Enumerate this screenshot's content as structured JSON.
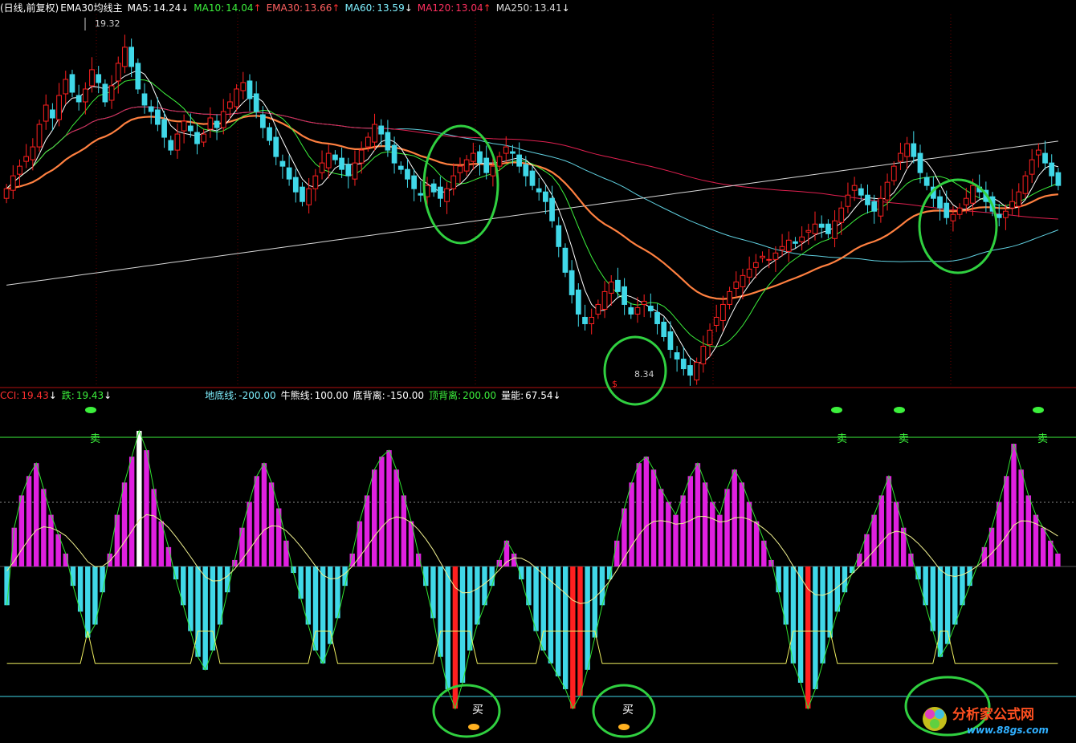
{
  "main_header": {
    "title": "(日线,前复权)",
    "indicator": "EMA30均线主",
    "items": [
      {
        "label": "MA5:",
        "value": "14.24",
        "color": "#ffffff",
        "trend": "down"
      },
      {
        "label": "MA10:",
        "value": "14.04",
        "color": "#3cf03c",
        "trend": "up"
      },
      {
        "label": "EMA30:",
        "value": "13.66",
        "color": "#ff6060",
        "trend": "up"
      },
      {
        "label": "MA60:",
        "value": "13.59",
        "color": "#7ff0ff",
        "trend": "down"
      },
      {
        "label": "MA120:",
        "value": "13.04",
        "color": "#ff3060",
        "trend": "up"
      },
      {
        "label": "MA250:",
        "value": "13.41",
        "color": "#d8d8d8",
        "trend": "down"
      }
    ]
  },
  "sub_header": {
    "items": [
      {
        "label": "CCI:",
        "value": "19.43",
        "color": "#ff3030",
        "trend": "down"
      },
      {
        "label": "跌:",
        "value": "19.43",
        "color": "#3cf03c",
        "trend": "down"
      },
      {
        "label": "地底线:",
        "value": "-200.00",
        "color": "#7ff0ff",
        "trend": ""
      },
      {
        "label": "牛熊线:",
        "value": "100.00",
        "color": "#ffffff",
        "trend": ""
      },
      {
        "label": "底背离:",
        "value": "-150.00",
        "color": "#ffffff",
        "trend": ""
      },
      {
        "label": "顶背离:",
        "value": "200.00",
        "color": "#3cf03c",
        "trend": ""
      },
      {
        "label": "量能:",
        "value": "67.54",
        "color": "#ffffff",
        "trend": "down"
      }
    ]
  },
  "annotations": {
    "high_price": "19.32",
    "low_price": "8.34",
    "sell_label": "卖",
    "buy_label": "买"
  },
  "watermark": {
    "name": "分析家公式网",
    "url": "www.88gs.com"
  },
  "colors": {
    "rise": "#ff2020",
    "fall": "#40d8e8",
    "ma5": "#ffffff",
    "ma10": "#3cf03c",
    "ema30": "#ff8040",
    "ma60": "#60d0e0",
    "ma120": "#e02050",
    "ma250": "#d8d8d8",
    "cci_pos": "#e020e0",
    "cci_neg": "#40d8e8",
    "circle": "#30d040"
  },
  "chart_data": [
    {
      "type": "candlestick",
      "y_range": [
        8.34,
        19.32
      ],
      "ma_series": [
        "MA5",
        "MA10",
        "EMA30",
        "MA60",
        "MA120",
        "MA250"
      ],
      "close": [
        14.2,
        14.6,
        14.9,
        15.2,
        15.5,
        16.2,
        16.8,
        16.4,
        17.1,
        17.6,
        17.2,
        16.9,
        17.3,
        17.9,
        17.5,
        16.9,
        17.4,
        18.1,
        18.6,
        18.0,
        17.3,
        16.8,
        16.6,
        16.2,
        15.8,
        15.4,
        15.9,
        16.3,
        16.0,
        15.6,
        15.9,
        16.4,
        16.1,
        16.6,
        16.9,
        17.3,
        17.5,
        17.0,
        16.6,
        16.1,
        15.7,
        15.2,
        14.9,
        14.5,
        14.1,
        13.8,
        14.2,
        14.6,
        15.0,
        15.3,
        15.1,
        14.8,
        14.6,
        15.0,
        15.4,
        15.8,
        16.2,
        15.9,
        15.4,
        15.0,
        14.8,
        14.5,
        14.2,
        14.0,
        14.3,
        14.1,
        13.9,
        14.2,
        14.6,
        14.9,
        15.1,
        15.3,
        15.0,
        14.7,
        14.9,
        15.2,
        15.5,
        15.3,
        14.9,
        14.6,
        14.3,
        14.1,
        13.8,
        13.2,
        12.4,
        11.6,
        10.9,
        10.3,
        10.0,
        10.2,
        10.6,
        11.0,
        11.3,
        11.0,
        10.6,
        10.3,
        10.5,
        10.7,
        10.4,
        10.0,
        9.6,
        9.2,
        8.9,
        8.6,
        8.4,
        8.8,
        9.3,
        9.8,
        10.2,
        10.6,
        11.0,
        11.3,
        11.5,
        11.7,
        11.9,
        12.1,
        12.0,
        12.2,
        12.4,
        12.6,
        12.5,
        12.7,
        12.9,
        13.1,
        13.0,
        12.8,
        13.2,
        13.6,
        14.0,
        14.3,
        14.0,
        13.7,
        13.5,
        13.9,
        14.4,
        14.9,
        15.3,
        15.6,
        15.2,
        14.7,
        14.3,
        13.9,
        13.6,
        13.3,
        13.4,
        13.6,
        13.9,
        14.3,
        14.1,
        13.8,
        13.5,
        13.3,
        13.5,
        13.8,
        14.1,
        14.6,
        15.1,
        15.4,
        15.0,
        14.6,
        14.3
      ]
    },
    {
      "type": "bar",
      "y_levels": {
        "顶背离": 200,
        "牛熊线": 100,
        "底背离": -150,
        "地底线": -200
      },
      "values": [
        -60,
        60,
        110,
        140,
        160,
        120,
        80,
        50,
        20,
        -30,
        -70,
        -110,
        -90,
        -40,
        20,
        80,
        130,
        170,
        210,
        180,
        120,
        70,
        30,
        -20,
        -60,
        -100,
        -140,
        -160,
        -130,
        -90,
        -40,
        10,
        60,
        100,
        140,
        160,
        130,
        90,
        40,
        -10,
        -50,
        -90,
        -130,
        -150,
        -120,
        -80,
        -30,
        20,
        70,
        110,
        150,
        170,
        180,
        150,
        110,
        70,
        20,
        -30,
        -80,
        -140,
        -190,
        -220,
        -180,
        -130,
        -90,
        -60,
        -30,
        10,
        40,
        20,
        -20,
        -60,
        -100,
        -130,
        -150,
        -170,
        -190,
        -220,
        -200,
        -160,
        -110,
        -60,
        -20,
        40,
        90,
        130,
        160,
        170,
        150,
        120,
        100,
        80,
        110,
        140,
        160,
        130,
        100,
        80,
        120,
        150,
        130,
        100,
        70,
        40,
        10,
        -40,
        -90,
        -150,
        -180,
        -220,
        -190,
        -150,
        -110,
        -70,
        -40,
        -10,
        20,
        50,
        80,
        110,
        140,
        100,
        60,
        20,
        -20,
        -60,
        -100,
        -140,
        -120,
        -90,
        -60,
        -30,
        0,
        30,
        60,
        100,
        140,
        190,
        150,
        110,
        80,
        60,
        40,
        20
      ]
    }
  ]
}
